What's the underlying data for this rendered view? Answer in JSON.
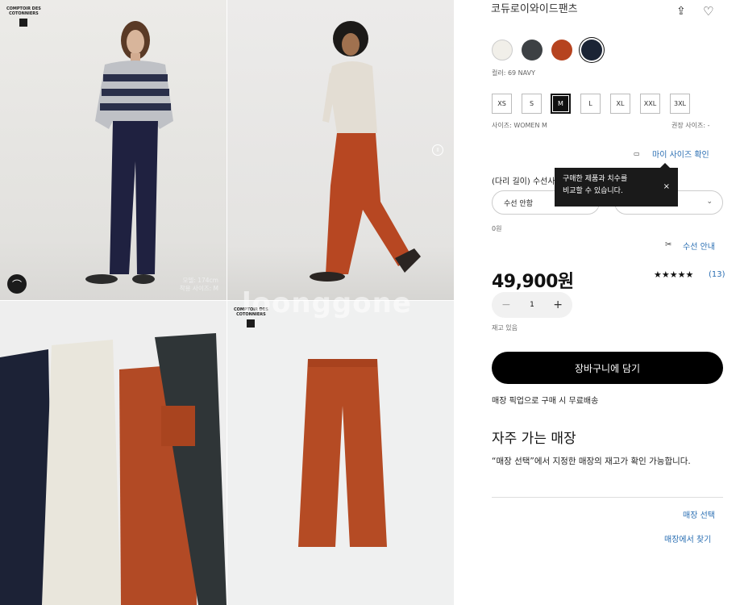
{
  "gallery": {
    "brand_line1": "COMPTOIR DES",
    "brand_line2": "COTONNIERS",
    "brand_mark": "UNI QLO",
    "model_height": "모델: 174cm",
    "model_size": "착용 사이즈: M",
    "watermark": "loonggone",
    "hanger_icon": "hanger-icon",
    "pause_icon": "pause-icon"
  },
  "product": {
    "title": "코듀로이와이드팬츠",
    "share_icon": "share-icon",
    "wishlist_icon": "heart-icon",
    "colors": [
      {
        "name": "OFF WHITE",
        "hex": "#f1efe9"
      },
      {
        "name": "DARK GRAY",
        "hex": "#3d4144"
      },
      {
        "name": "ORANGE",
        "hex": "#b6431f"
      },
      {
        "name": "69 NAVY",
        "hex": "#1b2435"
      }
    ],
    "color_label": "컬러: 69 NAVY",
    "sizes": [
      "XS",
      "S",
      "M",
      "L",
      "XL",
      "XXL",
      "3XL"
    ],
    "selected_size": "M",
    "size_label": "사이즈: WOMEN M",
    "recommended_size": "권장 사이즈: -",
    "my_size_link": "마이 사이즈 확인",
    "ruler_icon": "ruler-icon",
    "tooltip_line1": "구매한 제품과 치수를",
    "tooltip_line2": "비교할 수 있습니다.",
    "tooltip_close": "×",
    "leg_length_label": "(다리 길이) 수선사",
    "alteration_select": "수선 안함",
    "alteration_select2": "",
    "alteration_price": "0원",
    "alteration_guide": "수선 안내",
    "scissors_icon": "scissors-icon",
    "price": "49,900원",
    "rating_stars": "★★★★★",
    "rating": 5,
    "review_count": "(13)",
    "quantity": "1",
    "stock_status": "재고 있음",
    "add_to_cart": "장바구니에 담기",
    "free_shipping": "매장 픽업으로 구매 시 무료배송",
    "store_heading": "자주 가는 매장",
    "store_desc": "“매장 선택”에서 지정한 매장의 재고가 확인 가능합니다.",
    "select_store": "매장 선택",
    "find_in_store": "매장에서 찾기"
  }
}
